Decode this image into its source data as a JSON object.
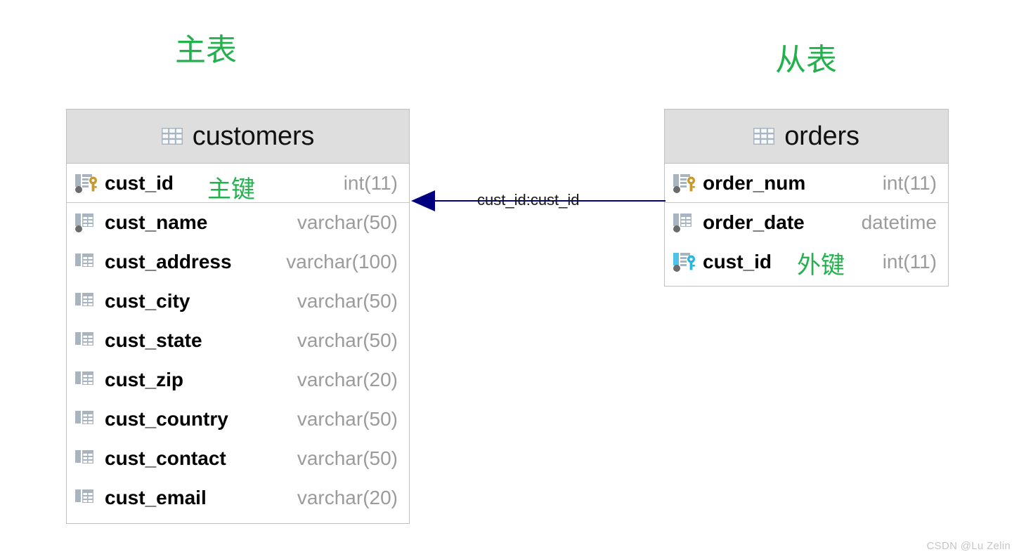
{
  "annotations": {
    "master_table_caption": "主表",
    "slave_table_caption": "从表",
    "primary_key_note": "主键",
    "foreign_key_note": "外键"
  },
  "colors": {
    "accent_green": "#22b14c",
    "header_gray": "#dedede",
    "type_gray": "#9b9b9b",
    "relation_navy": "#000080",
    "pk_key_gold": "#c79a2e",
    "fk_key_blue": "#4fc3e8",
    "column_icon_gray": "#a8b5c0"
  },
  "tables": [
    {
      "id": "customers",
      "name": "customers",
      "icon": "table-grid-icon",
      "columns": [
        {
          "name": "cust_id",
          "type": "int(11)",
          "icon": "primary-key-icon",
          "not_null": true,
          "note": "主键",
          "separator_below": true
        },
        {
          "name": "cust_name",
          "type": "varchar(50)",
          "icon": "column-icon",
          "not_null": true,
          "note": "",
          "separator_below": false
        },
        {
          "name": "cust_address",
          "type": "varchar(100)",
          "icon": "column-icon",
          "not_null": false,
          "note": "",
          "separator_below": false
        },
        {
          "name": "cust_city",
          "type": "varchar(50)",
          "icon": "column-icon",
          "not_null": false,
          "note": "",
          "separator_below": false
        },
        {
          "name": "cust_state",
          "type": "varchar(50)",
          "icon": "column-icon",
          "not_null": false,
          "note": "",
          "separator_below": false
        },
        {
          "name": "cust_zip",
          "type": "varchar(20)",
          "icon": "column-icon",
          "not_null": false,
          "note": "",
          "separator_below": false
        },
        {
          "name": "cust_country",
          "type": "varchar(50)",
          "icon": "column-icon",
          "not_null": false,
          "note": "",
          "separator_below": false
        },
        {
          "name": "cust_contact",
          "type": "varchar(50)",
          "icon": "column-icon",
          "not_null": false,
          "note": "",
          "separator_below": false
        },
        {
          "name": "cust_email",
          "type": "varchar(20)",
          "icon": "column-icon",
          "not_null": false,
          "note": "",
          "separator_below": false
        }
      ]
    },
    {
      "id": "orders",
      "name": "orders",
      "icon": "table-grid-icon",
      "columns": [
        {
          "name": "order_num",
          "type": "int(11)",
          "icon": "primary-key-icon",
          "not_null": true,
          "note": "",
          "separator_below": true
        },
        {
          "name": "order_date",
          "type": "datetime",
          "icon": "column-icon",
          "not_null": true,
          "note": "",
          "separator_below": false
        },
        {
          "name": "cust_id",
          "type": "int(11)",
          "icon": "foreign-key-icon",
          "not_null": true,
          "note": "外键",
          "separator_below": false
        }
      ]
    }
  ],
  "relationship": {
    "label": "cust_id:cust_id",
    "from_table": "orders",
    "to_table": "customers",
    "arrow_direction": "left",
    "arrow_style": "solid-triangle"
  },
  "watermark": {
    "text": "CSDN @Lu Zelin"
  }
}
